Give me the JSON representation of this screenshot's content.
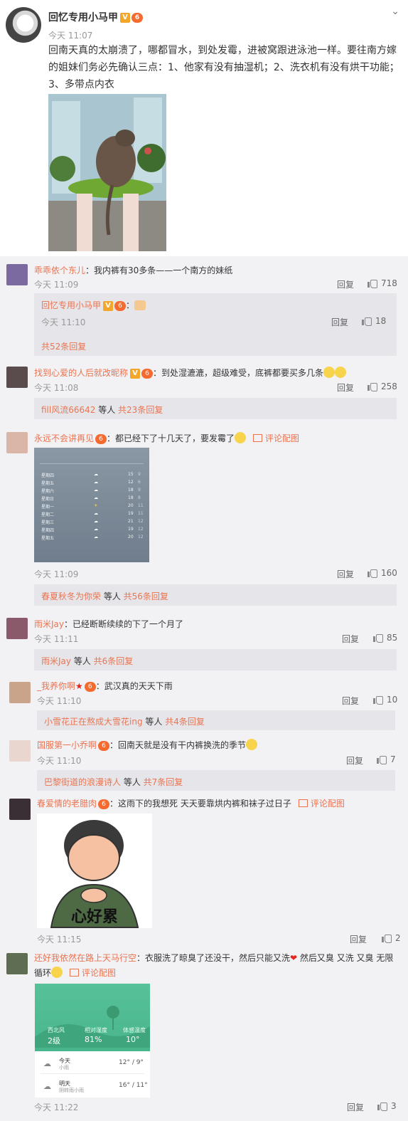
{
  "post": {
    "author": "回忆专用小马甲",
    "vip_badge": "V",
    "medal": "6",
    "time": "今天 11:07",
    "text": "回南天真的太崩溃了，哪都冒水，到处发霉，进被窝跟进泳池一样。要往南方嫁的姐妹们务必先确认三点：1、他家有没有抽湿机；2、洗衣机有没有烘干功能；3、多带点内衣"
  },
  "comments": [
    {
      "name": "乖乖依个东儿",
      "text": "：我内裤有30多条——一个南方的妹纸",
      "time": "今天 11:09",
      "reply": "回复",
      "likes": "718"
    },
    {
      "name": "回忆专用小马甲",
      "text": "：",
      "time": "今天 11:10",
      "reply": "回复",
      "likes": "18",
      "more": "共52条回复"
    },
    {
      "name": "找到心爱的人后就改昵称",
      "text": "：到处湿漉漉，超级难受，底裤都要买多几条",
      "time": "今天 11:08",
      "reply": "回复",
      "likes": "258",
      "sub_user": "fill风流66642",
      "sub_mid": " 等人 ",
      "sub_count": "共23条回复"
    },
    {
      "name": "永远不会讲再见",
      "text": "：都已经下了十几天了，要发霉了",
      "pic_label": "评论配图",
      "time": "今天 11:09",
      "reply": "回复",
      "likes": "160",
      "sub_user": "春夏秋冬为你荣",
      "sub_mid": " 等人 ",
      "sub_count": "共56条回复"
    },
    {
      "name": "雨米Jay",
      "text": "：已经断断续续的下了一个月了",
      "time": "今天 11:11",
      "reply": "回复",
      "likes": "85",
      "sub_user": "雨米Jay",
      "sub_mid": " 等人 ",
      "sub_count": "共6条回复"
    },
    {
      "name": "_我养你啊",
      "text": "：武汉真的天天下雨",
      "time": "今天 11:10",
      "reply": "回复",
      "likes": "10",
      "sub_user": "小雪花正在熬成大雪花ing",
      "sub_mid": " 等人 ",
      "sub_count": "共4条回复"
    },
    {
      "name": "国服第一小乔啊",
      "text": "：回南天就是没有干内裤换洗的季节",
      "time": "今天 11:10",
      "reply": "回复",
      "likes": "7",
      "sub_user": "巴黎街道的浪漫诗人",
      "sub_mid": " 等人 ",
      "sub_count": "共7条回复"
    },
    {
      "name": "春爱情的老腊肉",
      "text": "：这雨下的我想死 天天要靠烘内裤和袜子过日子",
      "pic_label": "评论配图",
      "time": "今天 11:15",
      "reply": "回复",
      "likes": "2",
      "meme_text": "心好累"
    },
    {
      "name": "还好我依然在路上天马行空",
      "text": "：衣服洗了晾臭了还没干，然后只能又洗",
      "text2": " 然后又臭 又洗 又臭 无限",
      "text3": "循环",
      "pic_label": "评论配图",
      "time": "今天 11:22",
      "reply": "回复",
      "likes": "3"
    }
  ],
  "weather1": {
    "rows": [
      [
        "星期四",
        "15",
        "9"
      ],
      [
        "星期五",
        "12",
        "6"
      ],
      [
        "星期六",
        "18",
        "9"
      ],
      [
        "星期日",
        "18",
        "8"
      ],
      [
        "星期一",
        "20",
        "11"
      ],
      [
        "星期二",
        "19",
        "11"
      ],
      [
        "星期三",
        "21",
        "12"
      ],
      [
        "星期四",
        "19",
        "12"
      ],
      [
        "星期五",
        "20",
        "12"
      ]
    ]
  },
  "weather2": {
    "wind_label": "西北风",
    "wind": "2级",
    "humidity_label": "相对湿度",
    "humidity": "81%",
    "feel_label": "体感温度",
    "feel": "10°",
    "today": "今天",
    "today_sub": "小雨",
    "today_temp": "12° / 9°",
    "tomorrow": "明天",
    "tomorrow_sub": "阴转雨小雨",
    "tomorrow_temp": "16° / 11°"
  },
  "colors": {
    "accent": "#eb7350",
    "bg": "#f2f2f5",
    "sub_bg": "#e6e6ea"
  }
}
